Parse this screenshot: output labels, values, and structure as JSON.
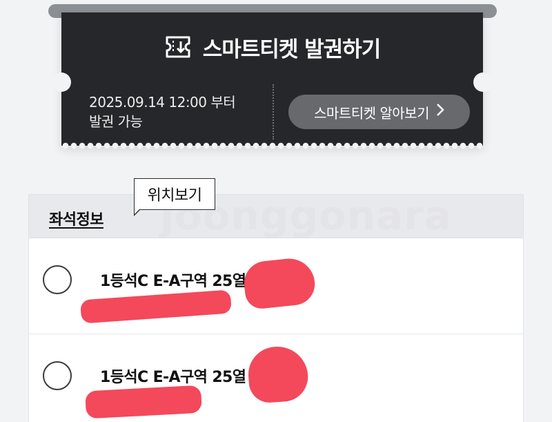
{
  "ticket": {
    "title": "스마트티켓 발권하기",
    "issue_date_line": "2025.09.14 12:00 부터",
    "issue_status_line": "발권 가능",
    "learn_more_label": "스마트티켓 알아보기",
    "icon": "ticket-download-icon",
    "chevron_icon": "chevron-right-icon"
  },
  "tooltip": {
    "label": "위치보기"
  },
  "seat_info": {
    "title": "좌석정보",
    "seats": [
      {
        "label": "1등석C E-A구역 25열"
      },
      {
        "label": "1등석C E-A구역 25열"
      }
    ]
  },
  "watermark": "joonggonara",
  "colors": {
    "ticket_bg": "#26272b",
    "button_bg": "#67696d",
    "redaction": "#f23a4d",
    "page_bg": "#f2f3f5"
  }
}
